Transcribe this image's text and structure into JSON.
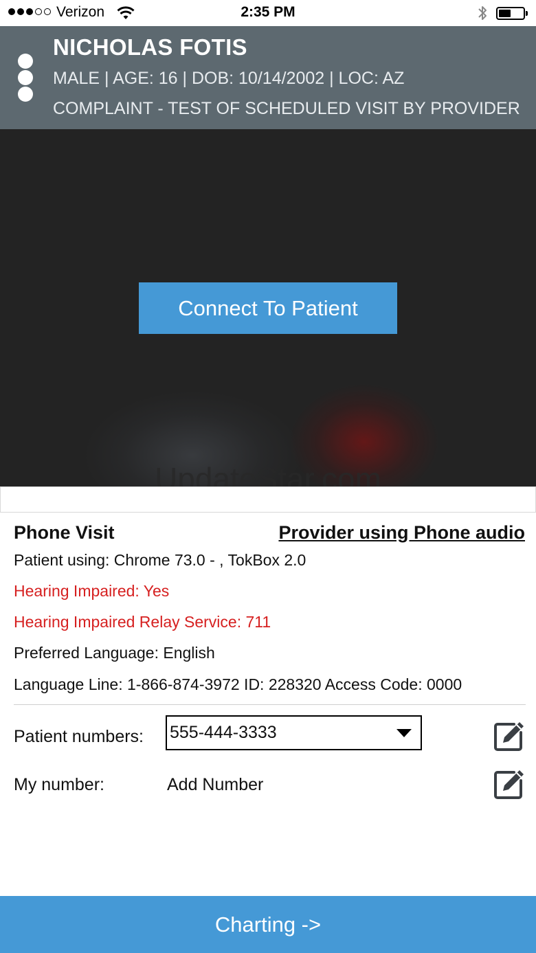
{
  "status_bar": {
    "carrier": "Verizon",
    "time": "2:35 PM",
    "signal_bars_filled": 3,
    "signal_bars_total": 5,
    "battery_level": 0.5
  },
  "patient": {
    "name": "NICHOLAS FOTIS",
    "info": "MALE | AGE: 16 | DOB: 10/14/2002 | LOC: AZ",
    "complaint": "COMPLAINT - TEST OF SCHEDULED VISIT BY PROVIDER"
  },
  "video": {
    "connect_label": "Connect To Patient",
    "watermark": "UpdateStar.com"
  },
  "visit": {
    "title": "Phone Visit",
    "audio_link": "Provider using Phone audio",
    "patient_using": "Patient using: Chrome 73.0 - , TokBox 2.0",
    "hearing_impaired": "Hearing Impaired: Yes",
    "relay_service": "Hearing Impaired Relay Service: 711",
    "preferred_language": "Preferred Language: English",
    "language_line": "Language Line: 1-866-874-3972 ID: 228320 Access Code: 0000"
  },
  "numbers": {
    "patient_label": "Patient numbers:",
    "patient_selected": "555-444-3333",
    "my_label": "My number:",
    "my_value": "Add Number"
  },
  "footer": {
    "charting_label": "Charting ->"
  },
  "colors": {
    "accent_blue": "#4599d6",
    "header_gray": "#5d6970",
    "alert_red": "#d62020"
  },
  "icons": [
    "wifi-icon",
    "bluetooth-icon",
    "battery-icon",
    "menu-dots-icon",
    "chevron-down-icon",
    "edit-icon"
  ]
}
